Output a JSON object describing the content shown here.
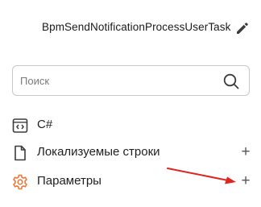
{
  "header": {
    "title": "BpmSendNotificationProcessUserTask",
    "edit_icon": "pencil-icon"
  },
  "search": {
    "placeholder": "Поиск",
    "value": "",
    "icon": "search-icon"
  },
  "items": [
    {
      "label": "C#",
      "icon": "code-file-icon",
      "has_add": false
    },
    {
      "label": "Локализуемые строки",
      "icon": "document-icon",
      "has_add": true,
      "add_label": "+"
    },
    {
      "label": "Параметры",
      "icon": "gear-icon",
      "has_add": true,
      "add_label": "+"
    }
  ],
  "colors": {
    "accent_orange": "#e8793a",
    "annotation_arrow": "#e0241f",
    "text": "#1f1f1f",
    "icon_gray": "#3b3b3b"
  }
}
